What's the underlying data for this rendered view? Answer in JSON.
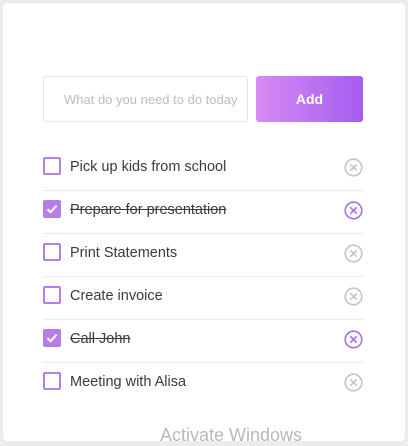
{
  "form": {
    "input_placeholder": "What do you need to do today?",
    "input_value": "",
    "add_label": "Add"
  },
  "colors": {
    "accent_start": "#d78cf3",
    "accent_end": "#a45cf0",
    "checkbox": "#b57ee8",
    "delete_inactive": "#c4c4c4",
    "delete_active": "#a66ef0"
  },
  "todos": [
    {
      "text": "Pick up kids from school",
      "done": false
    },
    {
      "text": "Prepare for presentation",
      "done": true
    },
    {
      "text": "Print Statements",
      "done": false
    },
    {
      "text": "Create invoice",
      "done": false
    },
    {
      "text": "Call John",
      "done": true
    },
    {
      "text": "Meeting with Alisa",
      "done": false
    }
  ],
  "icons": {
    "check": "check-icon",
    "delete": "close-circle-icon"
  },
  "watermark": "Activate Windows"
}
